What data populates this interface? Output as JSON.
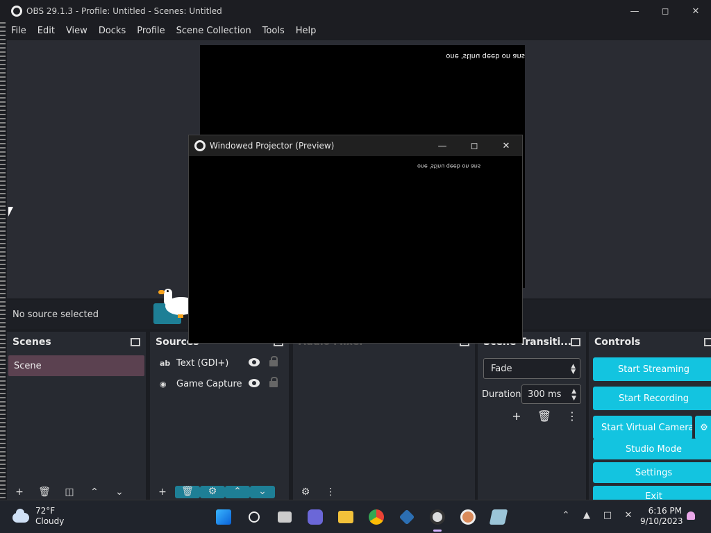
{
  "window": {
    "title": "OBS 29.1.3 - Profile: Untitled - Scenes: Untitled"
  },
  "menu": [
    "File",
    "Edit",
    "View",
    "Docks",
    "Profile",
    "Scene Collection",
    "Tools",
    "Help"
  ],
  "preview": {
    "mirrored_text": "one 'stinu qeeb on ans"
  },
  "projector": {
    "title": "Windowed Projector (Preview)",
    "mirrored_text": "one 'stinu qeeb on ans"
  },
  "source_bar": {
    "label": "No source selected"
  },
  "docks": {
    "scenes": {
      "title": "Scenes",
      "items": [
        "Scene"
      ]
    },
    "sources": {
      "title": "Sources",
      "items": [
        {
          "icon": "ab",
          "label": "Text (GDI+)"
        },
        {
          "icon": "gamepad",
          "label": "Game Capture"
        }
      ]
    },
    "audio_mixer": {
      "title": "Audio Mixer"
    },
    "transitions": {
      "title": "Scene Transiti...",
      "selected": "Fade",
      "duration_label": "Duration",
      "duration_value": "300 ms"
    },
    "controls": {
      "title": "Controls",
      "buttons": [
        "Start Streaming",
        "Start Recording",
        "Start Virtual Camera",
        "Studio Mode",
        "Settings",
        "Exit"
      ]
    }
  },
  "taskbar": {
    "temperature": "72°F",
    "condition": "Cloudy",
    "time": "6:16 PM",
    "date": "9/10/2023"
  },
  "colors": {
    "accent": "#13c4e0",
    "scene_selected": "#5b4150",
    "panel": "#272a31"
  }
}
